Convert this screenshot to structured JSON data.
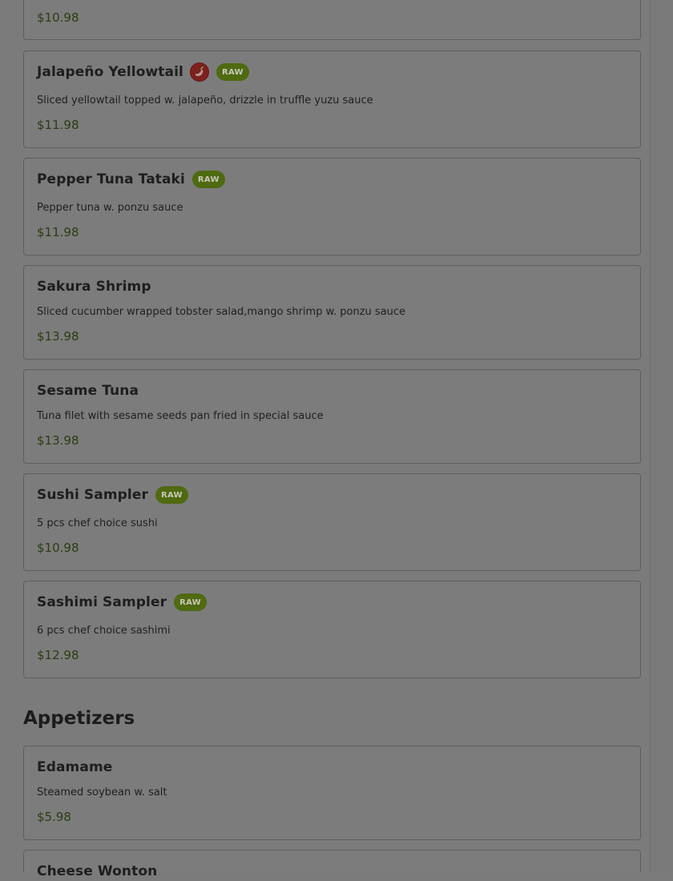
{
  "menu": {
    "top_partial_price": "$10.98",
    "items": [
      {
        "name": "Jalapeño Yellowtail",
        "spicy": true,
        "badge": "RAW",
        "description": "Sliced yellowtail topped w. jalapeño, drizzle in truffle yuzu sauce",
        "price": "$11.98"
      },
      {
        "name": "Pepper Tuna Tataki",
        "spicy": false,
        "badge": "RAW",
        "description": "Pepper tuna w. ponzu sauce",
        "price": "$11.98"
      },
      {
        "name": "Sakura Shrimp",
        "spicy": false,
        "badge": "",
        "description": "Sliced cucumber wrapped tobster salad,mango shrimp w. ponzu sauce",
        "price": "$13.98"
      },
      {
        "name": "Sesame Tuna",
        "spicy": false,
        "badge": "",
        "description": "Tuna filet with sesame seeds pan fried in special sauce",
        "price": "$13.98"
      },
      {
        "name": "Sushi Sampler",
        "spicy": false,
        "badge": "RAW",
        "description": "5 pcs chef choice sushi",
        "price": "$10.98"
      },
      {
        "name": "Sashimi Sampler",
        "spicy": false,
        "badge": "RAW",
        "description": "6 pcs chef choice sashimi",
        "price": "$12.98"
      }
    ],
    "section": {
      "title": "Appetizers",
      "items": [
        {
          "name": "Edamame",
          "description": "Steamed soybean w. salt",
          "price": "$5.98"
        },
        {
          "name": "Cheese Wonton"
        }
      ]
    }
  },
  "icons": {
    "spicy": "chili-pepper-icon"
  },
  "colors": {
    "badge_raw": "#4f6a10",
    "price": "#2a3d12",
    "spicy_icon": "#7d211f"
  }
}
